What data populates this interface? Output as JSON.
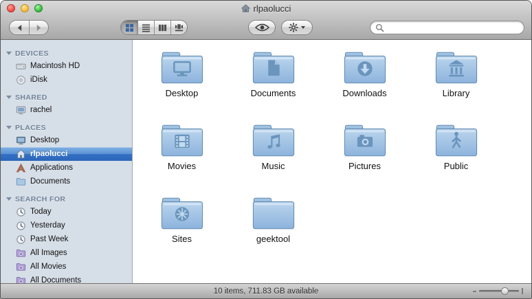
{
  "window": {
    "title": "rlpaolucci"
  },
  "toolbar": {
    "back_icon": "chevron-left",
    "forward_icon": "chevron-right",
    "view_modes": [
      {
        "name": "icon-view",
        "selected": true
      },
      {
        "name": "list-view",
        "selected": false
      },
      {
        "name": "column-view",
        "selected": false
      },
      {
        "name": "cover-flow-view",
        "selected": false
      }
    ],
    "quick_look_icon": "eye",
    "action_icon": "gear",
    "search": {
      "placeholder": "",
      "value": "",
      "icon": "magnifier"
    }
  },
  "sidebar": {
    "sections": [
      {
        "label": "DEVICES",
        "items": [
          {
            "label": "Macintosh HD",
            "icon": "hard-drive"
          },
          {
            "label": "iDisk",
            "icon": "idisk"
          }
        ]
      },
      {
        "label": "SHARED",
        "items": [
          {
            "label": "rachel",
            "icon": "shared-computer"
          }
        ]
      },
      {
        "label": "PLACES",
        "items": [
          {
            "label": "Desktop",
            "icon": "desktop-monitor"
          },
          {
            "label": "rlpaolucci",
            "icon": "home",
            "selected": true
          },
          {
            "label": "Applications",
            "icon": "applications-a"
          },
          {
            "label": "Documents",
            "icon": "blue-folder"
          }
        ]
      },
      {
        "label": "SEARCH FOR",
        "items": [
          {
            "label": "Today",
            "icon": "clock"
          },
          {
            "label": "Yesterday",
            "icon": "clock"
          },
          {
            "label": "Past Week",
            "icon": "clock"
          },
          {
            "label": "All Images",
            "icon": "smart-folder"
          },
          {
            "label": "All Movies",
            "icon": "smart-folder"
          },
          {
            "label": "All Documents",
            "icon": "smart-folder"
          }
        ]
      }
    ]
  },
  "content": {
    "folders": [
      {
        "label": "Desktop",
        "glyph": "monitor"
      },
      {
        "label": "Documents",
        "glyph": "document"
      },
      {
        "label": "Downloads",
        "glyph": "download-arrow"
      },
      {
        "label": "Library",
        "glyph": "columns-building"
      },
      {
        "label": "Movies",
        "glyph": "filmstrip"
      },
      {
        "label": "Music",
        "glyph": "music-notes"
      },
      {
        "label": "Pictures",
        "glyph": "camera"
      },
      {
        "label": "Public",
        "glyph": "walking-person"
      },
      {
        "label": "Sites",
        "glyph": "compass-wheel"
      },
      {
        "label": "geektool",
        "glyph": "none"
      }
    ]
  },
  "statusbar": {
    "text": "10 items, 711.83 GB available"
  },
  "colors": {
    "selection_blue": "#3a76c4",
    "folder_blue": "#9dbfe2",
    "smart_folder_purple": "#b1a0d8",
    "sidebar_bg": "#d6dee7"
  }
}
